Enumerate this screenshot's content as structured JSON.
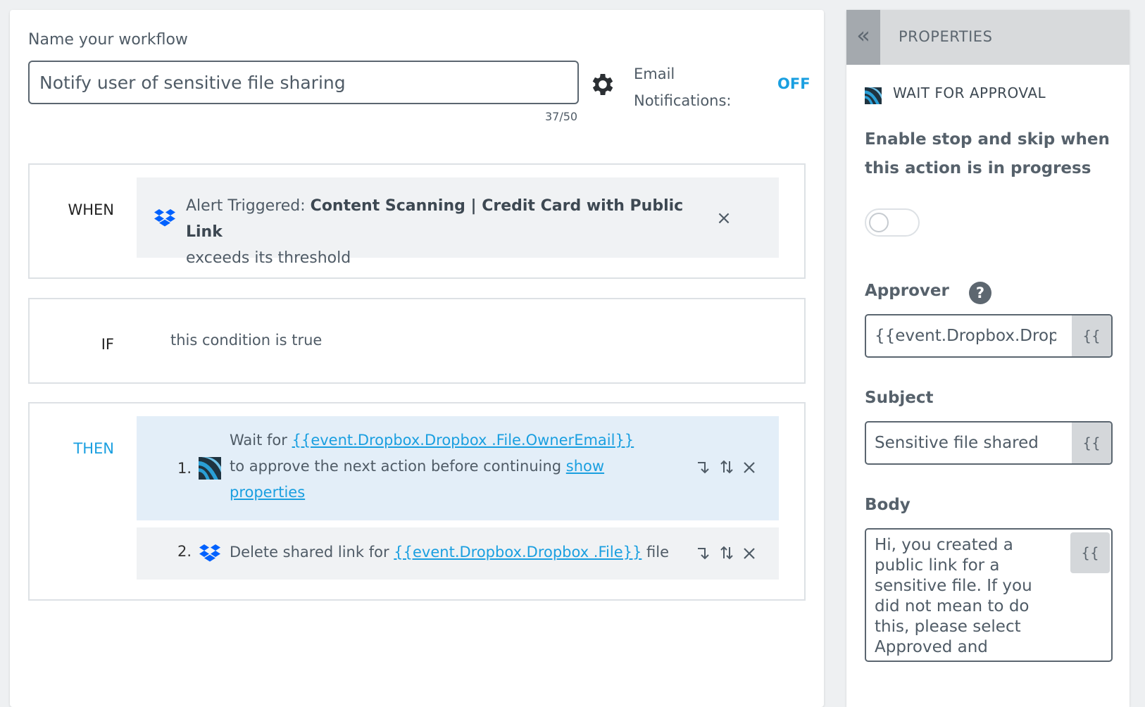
{
  "workflow": {
    "name_label": "Name your workflow",
    "name_value": "Notify user of sensitive file sharing",
    "char_count": "37/50",
    "settings_icon": "gear-icon",
    "email_label_line1": "Email",
    "email_label_line2": "Notifications:",
    "email_status": "OFF"
  },
  "when": {
    "label": "WHEN",
    "icon": "dropbox-icon",
    "prefix": "Alert Triggered:",
    "alert_name": "Content Scanning | Credit Card with Public Link",
    "suffix": "exceeds its threshold",
    "remove_icon": "close-icon"
  },
  "if": {
    "label": "IF",
    "text": "this condition is true"
  },
  "then": {
    "label": "THEN",
    "steps": [
      {
        "number": "1.",
        "icon": "approval-icon",
        "text_before": "Wait for",
        "variable": "{{event.Dropbox.Dropbox .File.OwnerEmail}}",
        "text_after": "to approve the next action before continuing",
        "link": "show properties",
        "selected": true
      },
      {
        "number": "2.",
        "icon": "dropbox-icon",
        "text_before": "Delete shared link for",
        "variable": "{{event.Dropbox.Dropbox .File}}",
        "text_after": "file",
        "selected": false
      }
    ],
    "step_action_icons": [
      "move-down-icon",
      "reorder-icon",
      "close-icon"
    ]
  },
  "properties": {
    "collapse_icon": "chevron-double-left-icon",
    "title": "PROPERTIES",
    "action_icon": "approval-icon",
    "action_title": "WAIT FOR APPROVAL",
    "enable_label": "Enable stop and skip when this action is in progress",
    "toggle_state": "off",
    "approver_label": "Approver",
    "approver_help_icon": "help-icon",
    "approver_value": "{{event.Dropbox.Drop",
    "subject_label": "Subject",
    "subject_value": "Sensitive file shared",
    "body_label": "Body",
    "body_value": "Hi, you created a public link for a sensitive file. If you did not mean to do this, please select Approved and",
    "variable_button": "{{"
  },
  "colors": {
    "accent": "#1a9fe0",
    "selected_step_bg": "#e3eef8",
    "card_bg": "#f0f2f4",
    "dropbox_blue": "#0061fe"
  }
}
